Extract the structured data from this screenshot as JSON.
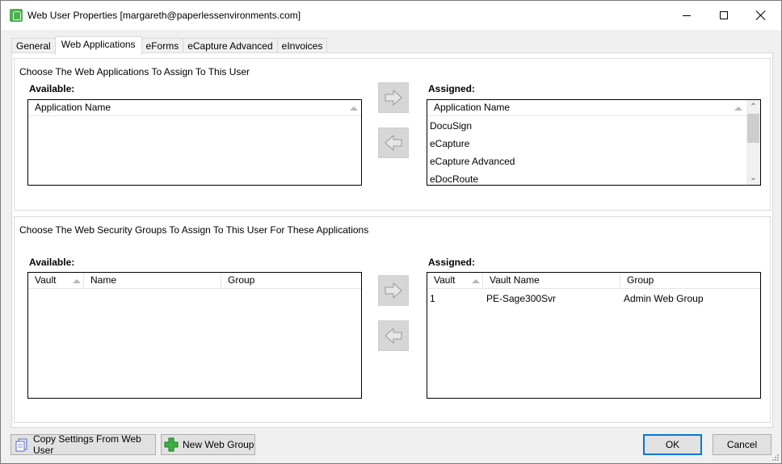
{
  "window": {
    "title": "Web User Properties [margareth@paperlessenvironments.com]",
    "controls": {
      "minimize": "minimize",
      "maximize": "maximize",
      "close": "close"
    }
  },
  "tabs": [
    {
      "label": "General",
      "active": false
    },
    {
      "label": "Web Applications",
      "active": true
    },
    {
      "label": "eForms",
      "active": false
    },
    {
      "label": "eCapture Advanced",
      "active": false
    },
    {
      "label": "eInvoices",
      "active": false
    }
  ],
  "applications_section": {
    "caption": "Choose The Web Applications To Assign To This User",
    "available": {
      "label": "Available:",
      "columns": [
        "Application Name"
      ],
      "rows": []
    },
    "assigned": {
      "label": "Assigned:",
      "columns": [
        "Application Name"
      ],
      "rows": [
        "DocuSign",
        "eCapture",
        "eCapture Advanced",
        "eDocRoute"
      ]
    },
    "assign_button_icon": "arrow-right-icon",
    "unassign_button_icon": "arrow-left-icon"
  },
  "groups_section": {
    "caption": "Choose The Web Security Groups To Assign To This User For These Applications",
    "available": {
      "label": "Available:",
      "columns": [
        "Vault",
        "Name",
        "Group"
      ],
      "rows": []
    },
    "assigned": {
      "label": "Assigned:",
      "columns": [
        "Vault",
        "Vault Name",
        "Group"
      ],
      "rows": [
        {
          "vault": "1",
          "vault_name": "PE-Sage300Svr",
          "group": "Admin Web Group"
        }
      ]
    }
  },
  "footer": {
    "copy_settings_label": "Copy Settings From Web User",
    "new_web_group_label": "New Web Group",
    "ok_label": "OK",
    "cancel_label": "Cancel"
  },
  "colors": {
    "accent_focus": "#0078d7",
    "app_icon": "#4caf50",
    "add_icon": "#3cb043"
  }
}
